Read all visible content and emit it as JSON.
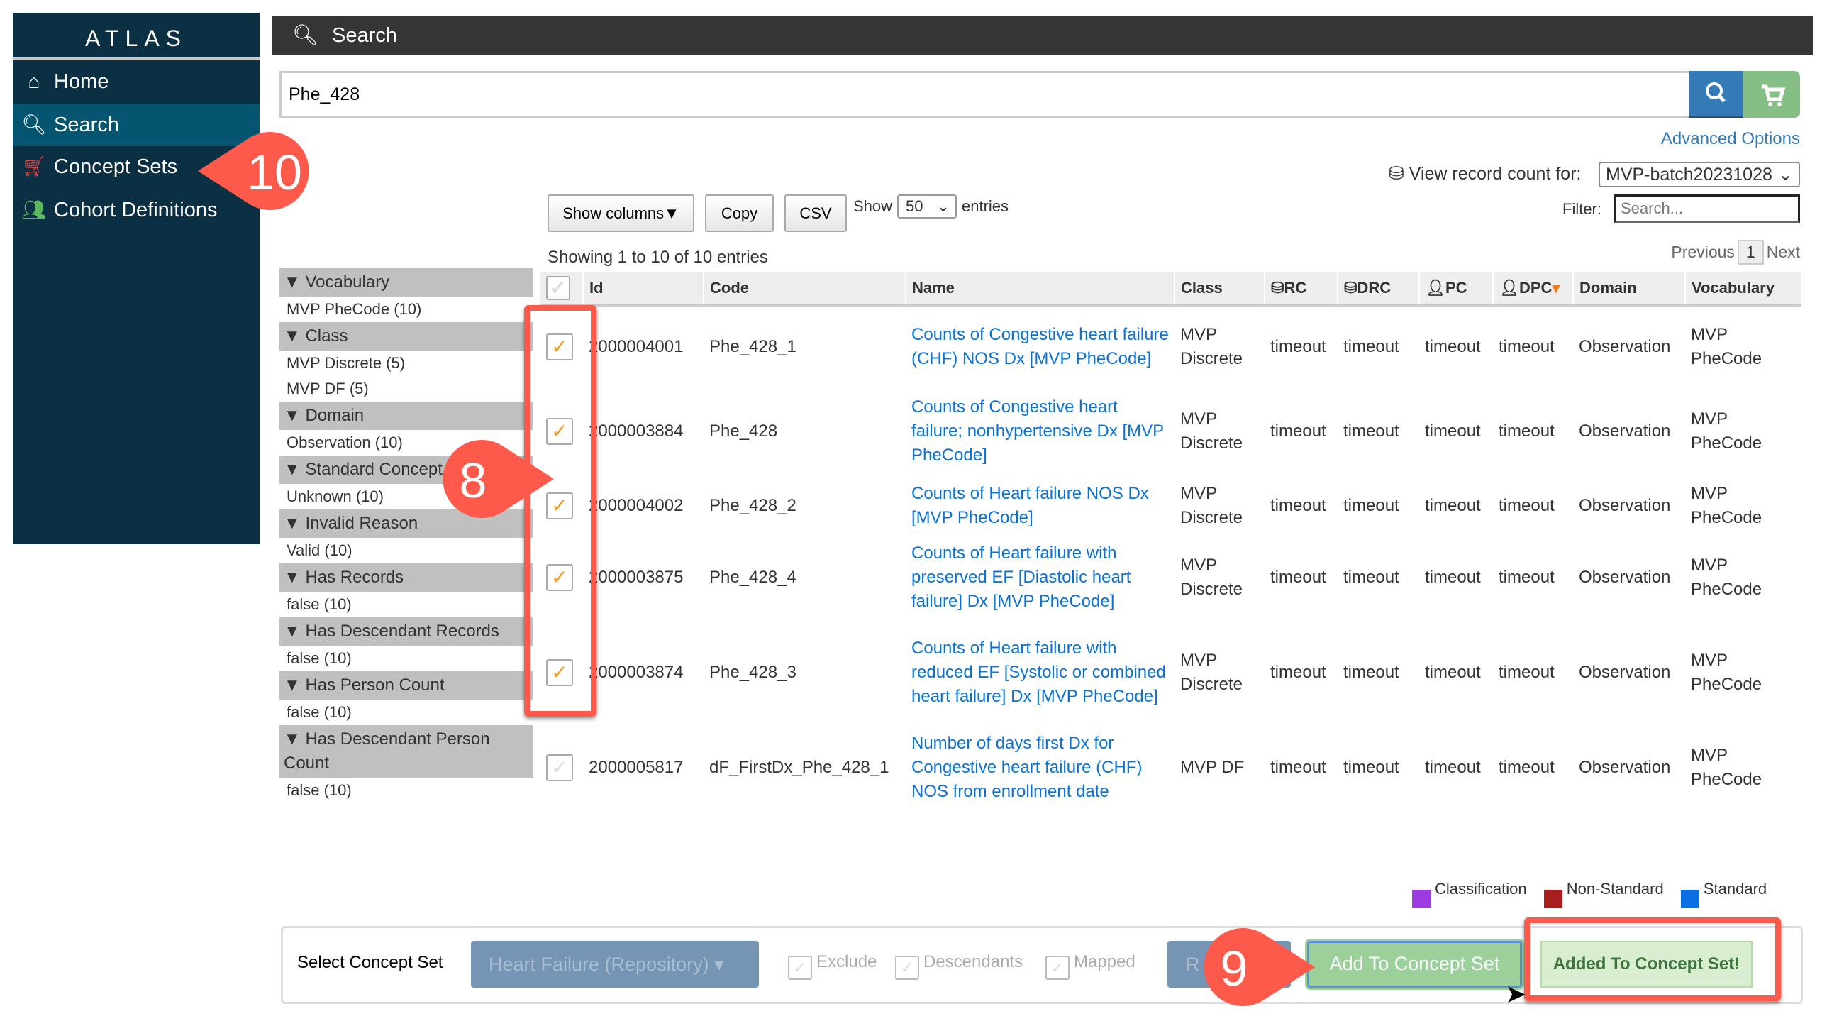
{
  "sidebar": {
    "logo": "ATLAS",
    "items": [
      {
        "label": "Home",
        "icon": "home-icon"
      },
      {
        "label": "Search",
        "icon": "search-icon",
        "active": true
      },
      {
        "label": "Concept Sets",
        "icon": "cart-icon"
      },
      {
        "label": "Cohort Definitions",
        "icon": "users-icon"
      }
    ]
  },
  "header": {
    "title": "Search"
  },
  "search": {
    "value": "Phe_428"
  },
  "advanced_options": "Advanced Options",
  "record_count": {
    "label": "View record count for:",
    "selected": "MVP-batch20231028"
  },
  "toolbar": {
    "show_columns": "Show columns▼",
    "copy": "Copy",
    "csv": "CSV",
    "show": "Show",
    "length": "50",
    "entries": "entries",
    "filter_label": "Filter:",
    "filter_placeholder": "Search..."
  },
  "info": "Showing 1 to 10 of 10 entries",
  "pager": {
    "previous": "Previous",
    "page": "1",
    "next": "Next"
  },
  "facets": [
    {
      "title": "Vocabulary",
      "items": [
        "MVP PheCode (10)"
      ]
    },
    {
      "title": "Class",
      "items": [
        "MVP Discrete (5)",
        "MVP DF (5)"
      ]
    },
    {
      "title": "Domain",
      "items": [
        "Observation (10)"
      ]
    },
    {
      "title": "Standard Concept",
      "items": [
        "Unknown (10)"
      ]
    },
    {
      "title": "Invalid Reason",
      "items": [
        "Valid (10)"
      ]
    },
    {
      "title": "Has Records",
      "items": [
        "false (10)"
      ]
    },
    {
      "title": "Has Descendant Records",
      "items": [
        "false (10)"
      ]
    },
    {
      "title": "Has Person Count",
      "items": [
        "false (10)"
      ]
    },
    {
      "title": "Has Descendant Person Count",
      "items": [
        "false (10)"
      ]
    }
  ],
  "table": {
    "columns": [
      "",
      "Id",
      "Code",
      "Name",
      "Class",
      "RC",
      "DRC",
      "PC",
      "DPC",
      "Domain",
      "Vocabulary"
    ],
    "rows": [
      {
        "checked": true,
        "id": "2000004001",
        "code": "Phe_428_1",
        "name": "Counts of Congestive heart failure (CHF) NOS Dx [MVP PheCode]",
        "class": "MVP Discrete",
        "rc": "timeout",
        "drc": "timeout",
        "pc": "timeout",
        "dpc": "timeout",
        "domain": "Observation",
        "vocabulary": "MVP PheCode"
      },
      {
        "checked": true,
        "id": "2000003884",
        "code": "Phe_428",
        "name": "Counts of Congestive heart failure; nonhypertensive Dx [MVP PheCode]",
        "class": "MVP Discrete",
        "rc": "timeout",
        "drc": "timeout",
        "pc": "timeout",
        "dpc": "timeout",
        "domain": "Observation",
        "vocabulary": "MVP PheCode"
      },
      {
        "checked": true,
        "id": "2000004002",
        "code": "Phe_428_2",
        "name": "Counts of Heart failure NOS Dx [MVP PheCode]",
        "class": "MVP Discrete",
        "rc": "timeout",
        "drc": "timeout",
        "pc": "timeout",
        "dpc": "timeout",
        "domain": "Observation",
        "vocabulary": "MVP PheCode"
      },
      {
        "checked": true,
        "id": "2000003875",
        "code": "Phe_428_4",
        "name": "Counts of Heart failure with preserved EF [Diastolic heart failure] Dx [MVP PheCode]",
        "class": "MVP Discrete",
        "rc": "timeout",
        "drc": "timeout",
        "pc": "timeout",
        "dpc": "timeout",
        "domain": "Observation",
        "vocabulary": "MVP PheCode"
      },
      {
        "checked": true,
        "id": "2000003874",
        "code": "Phe_428_3",
        "name": "Counts of Heart failure with reduced EF [Systolic or combined heart failure] Dx [MVP PheCode]",
        "class": "MVP Discrete",
        "rc": "timeout",
        "drc": "timeout",
        "pc": "timeout",
        "dpc": "timeout",
        "domain": "Observation",
        "vocabulary": "MVP PheCode"
      },
      {
        "checked": false,
        "id": "2000005817",
        "code": "dF_FirstDx_Phe_428_1",
        "name": "Number of days first Dx for Congestive heart failure (CHF) NOS from enrollment date",
        "class": "MVP DF",
        "rc": "timeout",
        "drc": "timeout",
        "pc": "timeout",
        "dpc": "timeout",
        "domain": "Observation",
        "vocabulary": "MVP PheCode"
      }
    ]
  },
  "legend": [
    {
      "label": "Classification",
      "color": "#9b3be0"
    },
    {
      "label": "Non-Standard",
      "color": "#a81d1d"
    },
    {
      "label": "Standard",
      "color": "#0a6fe0"
    }
  ],
  "bottom": {
    "select_label": "Select Concept Set",
    "concept_set": "Heart Failure (Repository) ▾",
    "exclude": "Exclude",
    "descendants": "Descendants",
    "mapped": "Mapped",
    "hidden_button": "R",
    "add": "Add To Concept Set",
    "added": "Added To Concept Set!"
  },
  "annotations": {
    "step8": "8",
    "step9": "9",
    "step10": "10",
    "color": "#fd5a4b"
  }
}
